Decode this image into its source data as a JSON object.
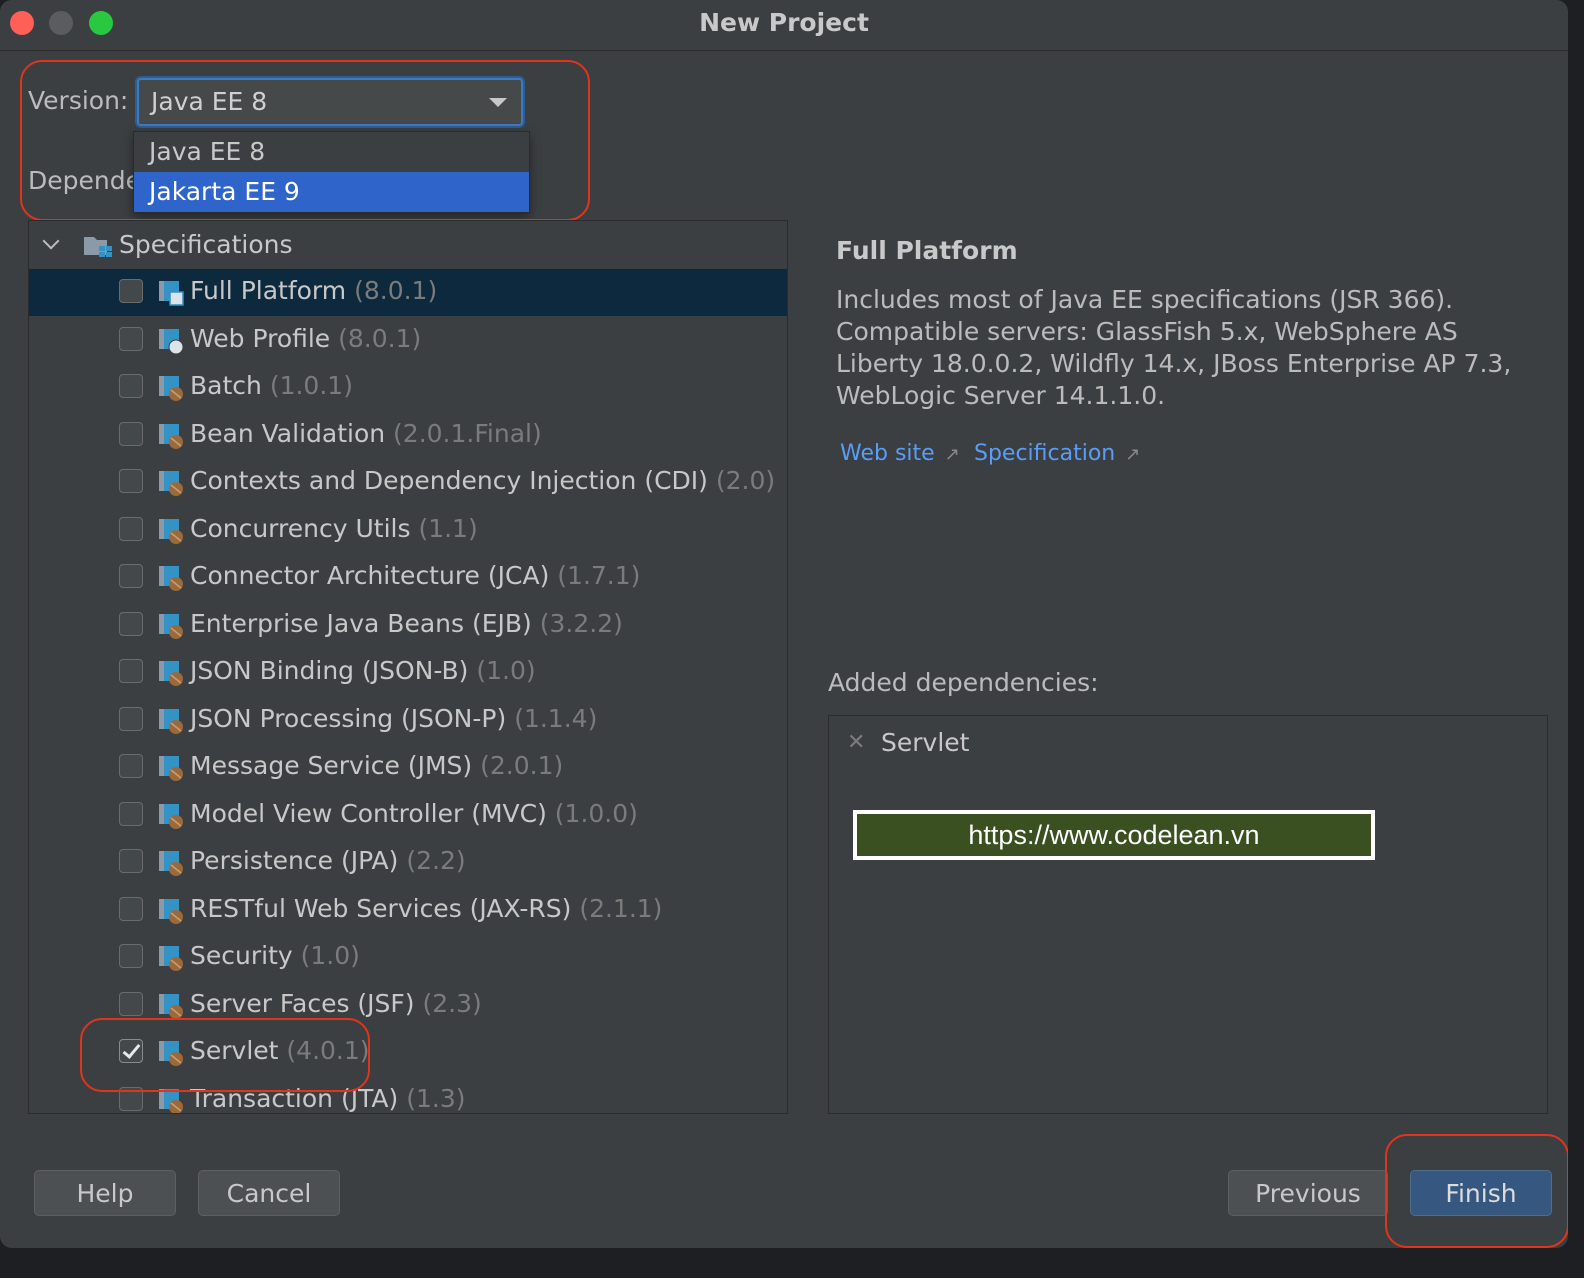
{
  "window": {
    "title": "New Project"
  },
  "version": {
    "label": "Version:",
    "selected": "Java EE 8",
    "options": [
      "Java EE 8",
      "Jakarta EE 9"
    ],
    "highlighted": "Jakarta EE 9"
  },
  "dependencies": {
    "label_visible": "Depende"
  },
  "tree": {
    "root_label": "Specifications",
    "items": [
      {
        "label": "Full Platform",
        "version": "(8.0.1)",
        "checked": false,
        "selected": true,
        "icon": "platform-icon"
      },
      {
        "label": "Web Profile",
        "version": "(8.0.1)",
        "checked": false,
        "icon": "web-library-icon"
      },
      {
        "label": "Batch",
        "version": "(1.0.1)",
        "checked": false,
        "icon": "library-icon"
      },
      {
        "label": "Bean Validation",
        "version": "(2.0.1.Final)",
        "checked": false,
        "icon": "library-icon"
      },
      {
        "label": "Contexts and Dependency Injection (CDI)",
        "version": "(2.0)",
        "checked": false,
        "icon": "library-icon"
      },
      {
        "label": "Concurrency Utils",
        "version": "(1.1)",
        "checked": false,
        "icon": "library-icon"
      },
      {
        "label": "Connector Architecture (JCA)",
        "version": "(1.7.1)",
        "checked": false,
        "icon": "library-icon"
      },
      {
        "label": "Enterprise Java Beans (EJB)",
        "version": "(3.2.2)",
        "checked": false,
        "icon": "library-icon"
      },
      {
        "label": "JSON Binding (JSON-B)",
        "version": "(1.0)",
        "checked": false,
        "icon": "library-icon"
      },
      {
        "label": "JSON Processing (JSON-P)",
        "version": "(1.1.4)",
        "checked": false,
        "icon": "library-icon"
      },
      {
        "label": "Message Service (JMS)",
        "version": "(2.0.1)",
        "checked": false,
        "icon": "library-icon"
      },
      {
        "label": "Model View Controller (MVC)",
        "version": "(1.0.0)",
        "checked": false,
        "icon": "library-icon"
      },
      {
        "label": "Persistence (JPA)",
        "version": "(2.2)",
        "checked": false,
        "icon": "library-icon"
      },
      {
        "label": "RESTful Web Services (JAX-RS)",
        "version": "(2.1.1)",
        "checked": false,
        "icon": "library-icon"
      },
      {
        "label": "Security",
        "version": "(1.0)",
        "checked": false,
        "icon": "library-icon"
      },
      {
        "label": "Server Faces (JSF)",
        "version": "(2.3)",
        "checked": false,
        "icon": "library-icon"
      },
      {
        "label": "Servlet",
        "version": "(4.0.1)",
        "checked": true,
        "icon": "library-icon"
      },
      {
        "label": "Transaction (JTA)",
        "version": "(1.3)",
        "checked": false,
        "icon": "library-icon"
      }
    ]
  },
  "details": {
    "title": "Full Platform",
    "description": "Includes most of Java EE specifications (JSR 366). Compatible servers: GlassFish 5.x, WebSphere AS Liberty 18.0.0.2, Wildfly 14.x, JBoss Enterprise AP 7.3, WebLogic Server 14.1.1.0.",
    "links": [
      {
        "label": "Web site",
        "icon": "external-link-icon",
        "glyph": "↗"
      },
      {
        "label": "Specification",
        "icon": "external-link-icon",
        "glyph": "↗"
      }
    ]
  },
  "added": {
    "label": "Added dependencies:",
    "items": [
      {
        "name": "Servlet",
        "remove_glyph": "✕"
      }
    ],
    "watermark": "https://www.codelean.vn"
  },
  "buttons": {
    "help": "Help",
    "cancel": "Cancel",
    "previous": "Previous",
    "finish": "Finish"
  },
  "colors": {
    "accent": "#2f65ca",
    "link": "#589df6",
    "annotation": "#e0341c",
    "primary_button": "#365880"
  }
}
